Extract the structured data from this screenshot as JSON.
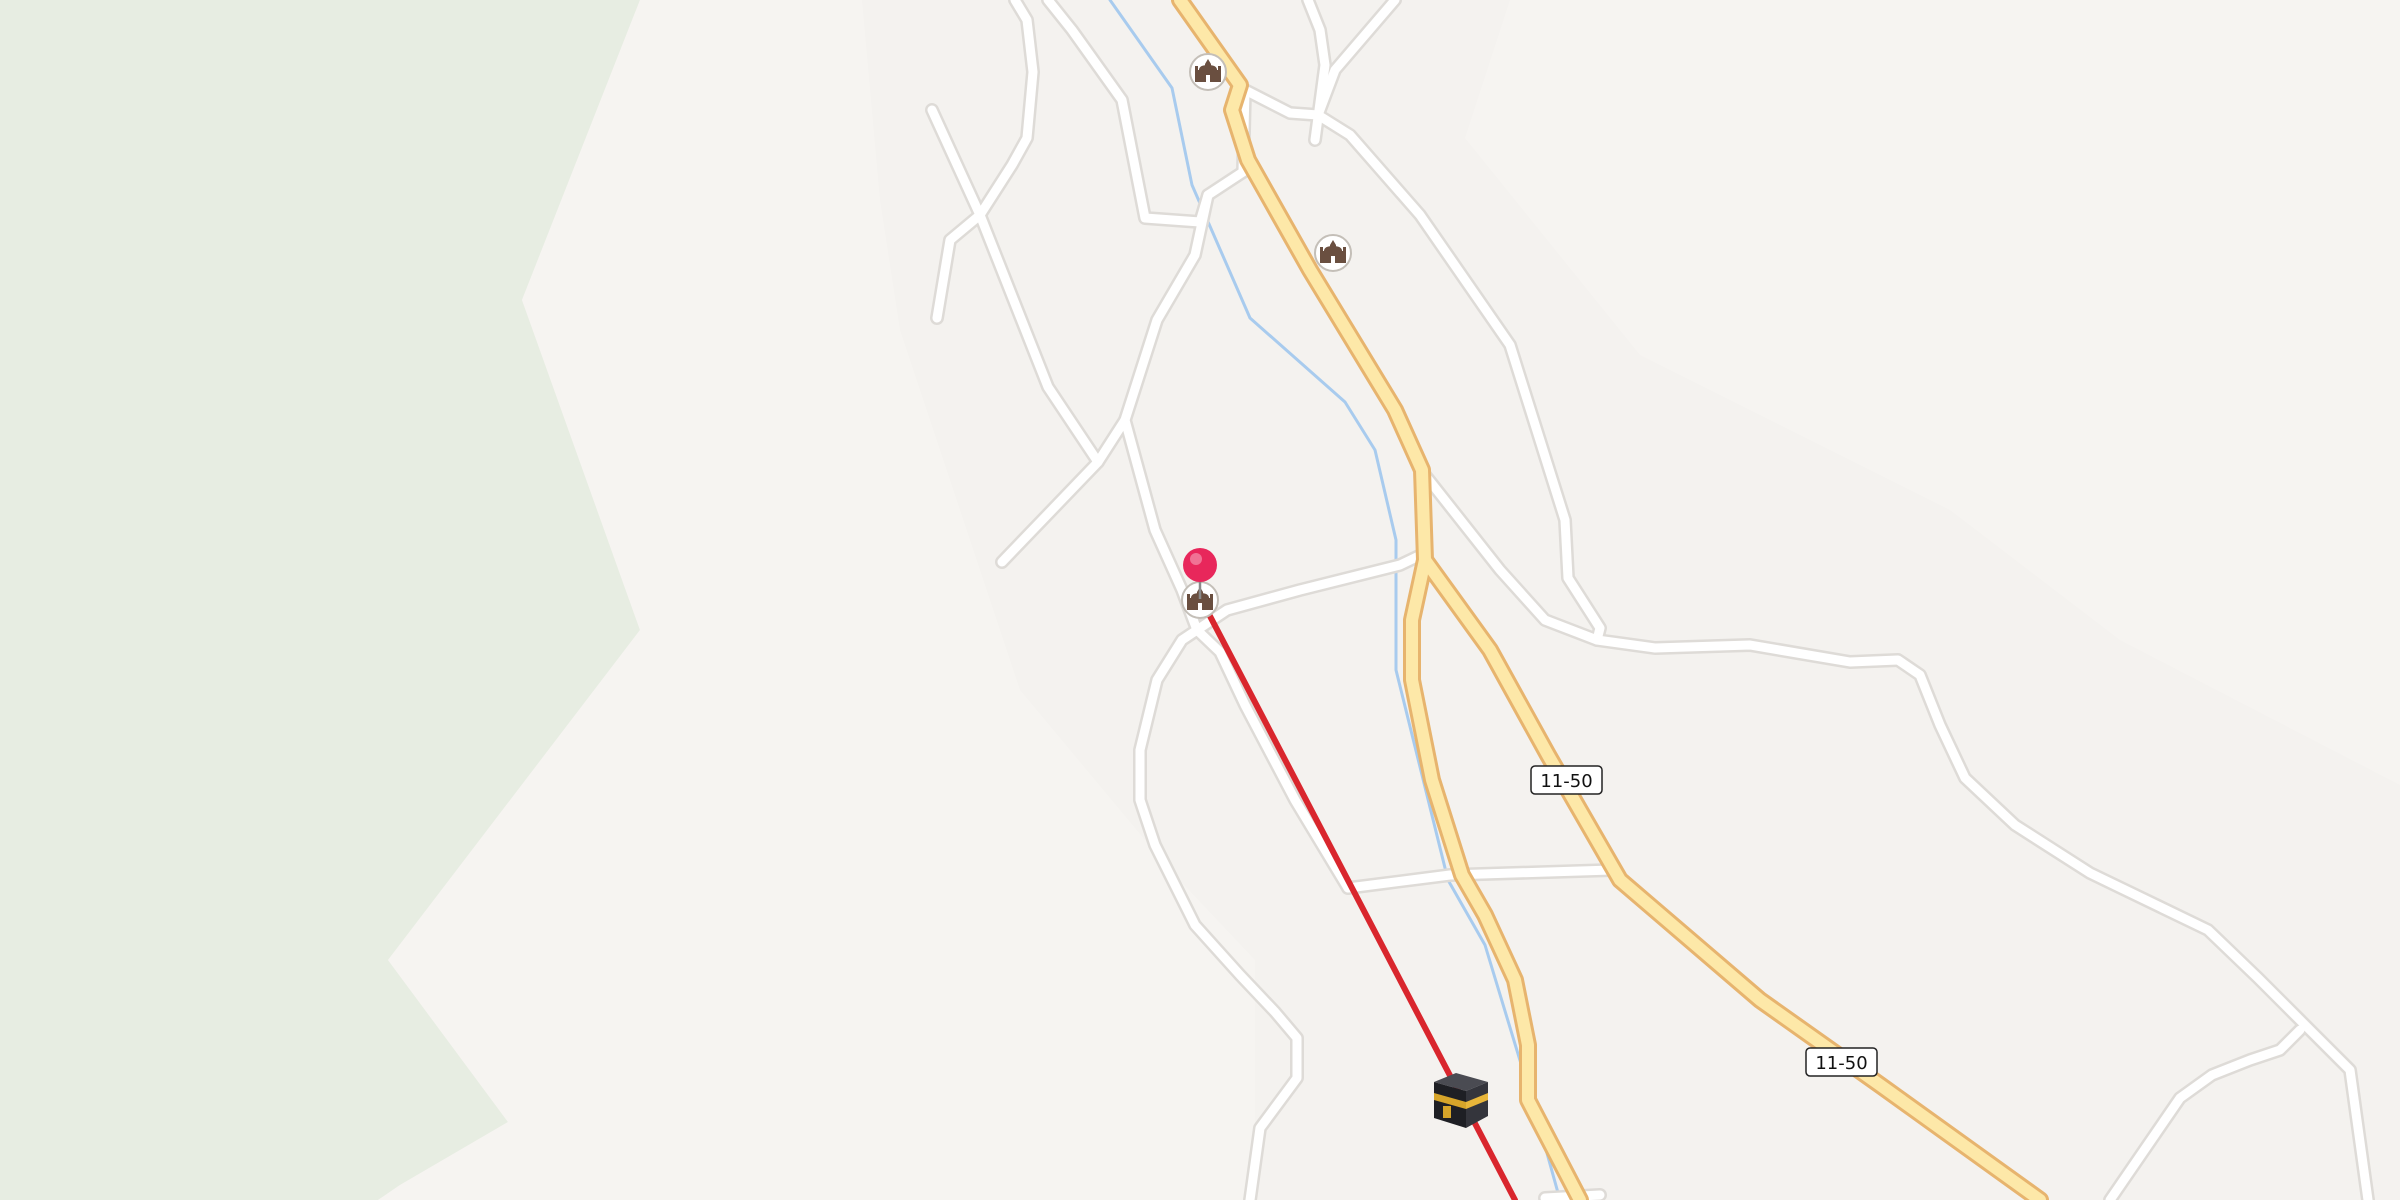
{
  "map": {
    "colors": {
      "background": "#f4f2ef",
      "vegetation": "#e7ede2",
      "plain": "#f6f4f1",
      "minor_road": "#ffffff",
      "minor_road_casing": "#dedbd7",
      "major_road_fill": "#fde8a8",
      "major_road_casing": "#e7b46e",
      "waterway": "#a8cbee",
      "route_line": "#d9262d",
      "pin": "#e8275b",
      "poi_fill": "#ffffff",
      "poi_stroke": "#c4bfb8",
      "poi_icon": "#6a4f40"
    },
    "road_labels": [
      {
        "ref": "11-50"
      },
      {
        "ref": "11-50"
      }
    ],
    "pois": [
      {
        "kind": "mosque",
        "icon": "mosque-icon"
      },
      {
        "kind": "mosque",
        "icon": "mosque-icon"
      },
      {
        "kind": "mosque",
        "icon": "mosque-icon"
      }
    ],
    "markers": {
      "start": {
        "icon": "map-pin-icon",
        "color": "#e8275b"
      },
      "destination": {
        "icon": "kaaba-icon"
      }
    }
  }
}
